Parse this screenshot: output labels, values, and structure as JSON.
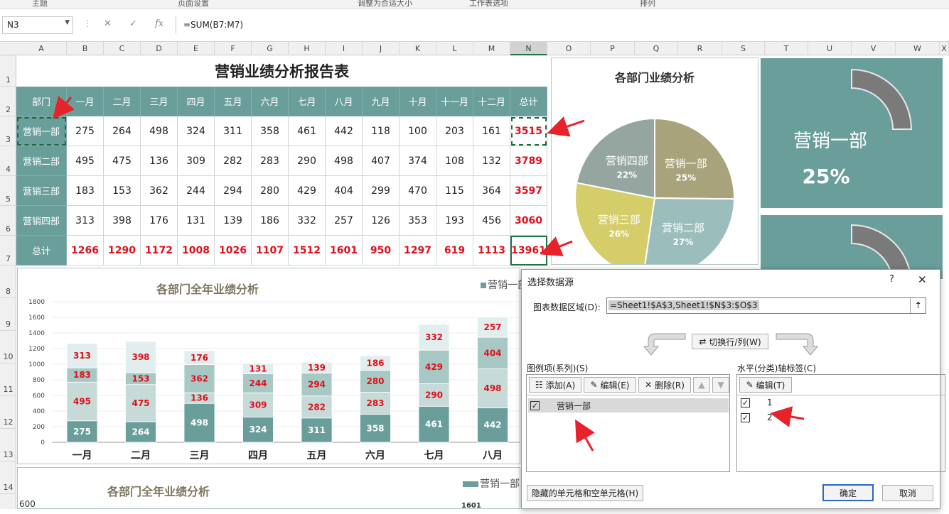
{
  "ribbon": {
    "groups": [
      "主题",
      "页面设置",
      "调整为合适大小",
      "工作表选项",
      "排列"
    ]
  },
  "formula_bar": {
    "name_box": "N3",
    "fx": "fx",
    "formula": "=SUM(B7:M7)"
  },
  "columns": [
    "A",
    "B",
    "C",
    "D",
    "E",
    "F",
    "G",
    "H",
    "I",
    "J",
    "K",
    "L",
    "M",
    "N",
    "O",
    "P",
    "Q",
    "R",
    "S",
    "T",
    "U",
    "V",
    "W",
    "X"
  ],
  "rows": [
    "1",
    "2",
    "3",
    "4",
    "5",
    "6",
    "7",
    "8",
    "9",
    "10",
    "11",
    "12",
    "13",
    "14"
  ],
  "sheet": {
    "title": "营销业绩分析报告表",
    "headers": [
      "部门",
      "一月",
      "二月",
      "三月",
      "四月",
      "五月",
      "六月",
      "七月",
      "八月",
      "九月",
      "十月",
      "十一月",
      "十二月",
      "总计"
    ],
    "data": [
      {
        "dept": "营销一部",
        "values": [
          "275",
          "264",
          "498",
          "324",
          "311",
          "358",
          "461",
          "442",
          "118",
          "100",
          "203",
          "161"
        ],
        "total": "3515"
      },
      {
        "dept": "营销二部",
        "values": [
          "495",
          "475",
          "136",
          "309",
          "282",
          "283",
          "290",
          "498",
          "407",
          "374",
          "108",
          "132"
        ],
        "total": "3789"
      },
      {
        "dept": "营销三部",
        "values": [
          "183",
          "153",
          "362",
          "244",
          "294",
          "280",
          "429",
          "404",
          "299",
          "470",
          "115",
          "364"
        ],
        "total": "3597"
      },
      {
        "dept": "营销四部",
        "values": [
          "313",
          "398",
          "176",
          "131",
          "139",
          "186",
          "332",
          "257",
          "126",
          "353",
          "193",
          "456"
        ],
        "total": "3060"
      }
    ],
    "total_row": {
      "label": "总计",
      "values": [
        "1266",
        "1290",
        "1172",
        "1008",
        "1026",
        "1107",
        "1512",
        "1601",
        "950",
        "1297",
        "619",
        "1113"
      ],
      "total": "13961"
    }
  },
  "chart_data": [
    {
      "type": "pie",
      "title": "各部门业绩分析",
      "categories": [
        "营销一部",
        "营销二部",
        "营销三部",
        "营销四部"
      ],
      "values": [
        3515,
        3789,
        3597,
        3060
      ],
      "labels": [
        "25%",
        "27%",
        "26%",
        "22%"
      ],
      "colors": [
        "#a8a37a",
        "#9bbdbb",
        "#d4cd6a",
        "#94a69f"
      ]
    },
    {
      "type": "bar",
      "stacked": true,
      "title": "各部门全年业绩分析",
      "legend": "营销一部",
      "categories": [
        "一月",
        "二月",
        "三月",
        "四月",
        "五月",
        "六月",
        "七月",
        "八月"
      ],
      "series": [
        {
          "name": "营销一部",
          "values": [
            275,
            264,
            498,
            324,
            311,
            358,
            461,
            442
          ],
          "color": "#6a9e9b"
        },
        {
          "values": [
            495,
            475,
            136,
            309,
            282,
            283,
            290,
            498
          ],
          "color": "#c6dad8"
        },
        {
          "values": [
            183,
            153,
            362,
            244,
            294,
            280,
            429,
            404
          ],
          "color": "#a8c8c5"
        },
        {
          "values": [
            313,
            398,
            176,
            131,
            139,
            186,
            332,
            257
          ],
          "color": "#e2eeed"
        }
      ],
      "ylim": [
        0,
        1800
      ],
      "yticks": [
        "0",
        "200",
        "400",
        "600",
        "800",
        "1000",
        "1200",
        "1400",
        "1600",
        "1800"
      ]
    },
    {
      "type": "bar",
      "title": "各部门全年业绩分析",
      "legend": "营销一部",
      "visible_ytick": "600",
      "visible_value": "1601"
    }
  ],
  "gauges": [
    {
      "name": "营销一部",
      "percent": "25%"
    }
  ],
  "dialog": {
    "title": "选择数据源",
    "help": "?",
    "close": "✕",
    "range_label": "图表数据区域(D):",
    "range_value": "=Sheet1!$A$3,Sheet1!$N$3:$O$3",
    "switch_label": "切换行/列(W)",
    "series_header": "图例项(系列)(S)",
    "axis_header": "水平(分类)轴标签(C)",
    "add_label": "添加(A)",
    "edit_label": "编辑(E)",
    "delete_label": "删除(R)",
    "axis_edit_label": "编辑(T)",
    "series_items": [
      {
        "label": "营销一部",
        "checked": true
      }
    ],
    "axis_items": [
      {
        "label": "1",
        "checked": true
      },
      {
        "label": "2",
        "checked": true
      }
    ],
    "hidden_cells": "隐藏的单元格和空单元格(H)",
    "ok": "确定",
    "cancel": "取消"
  },
  "colors": {
    "teal": "#6a9e9b",
    "red": "#e0101a",
    "gauge": "#7a7a7a"
  }
}
